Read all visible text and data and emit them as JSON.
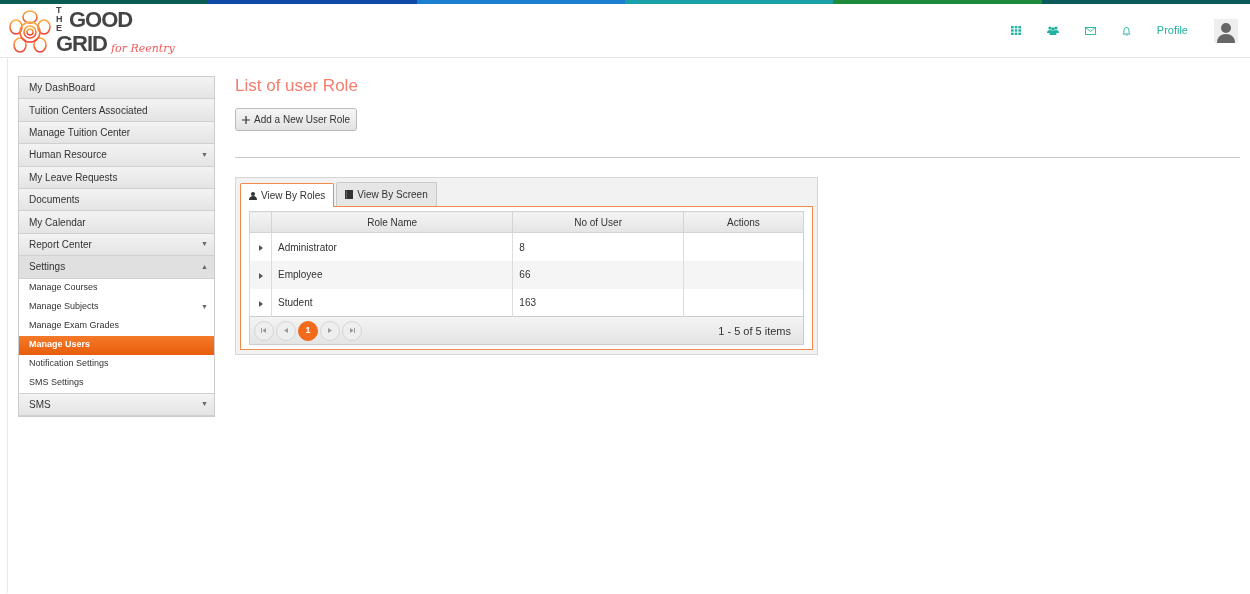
{
  "logo": {
    "the": "THE",
    "good": "GOOD",
    "grid": "GRID",
    "tagline": "for Reentry"
  },
  "header": {
    "profile": "Profile"
  },
  "sidebar": {
    "items": [
      {
        "label": "My DashBoard",
        "selected": false
      },
      {
        "label": "Tuition Centers Associated",
        "selected": false
      },
      {
        "label": "Manage Tuition Center",
        "selected": false
      },
      {
        "label": "Human Resource",
        "caret": "▼",
        "selected": false
      },
      {
        "label": "My Leave Requests",
        "selected": false
      },
      {
        "label": "Documents",
        "selected": false
      },
      {
        "label": "My Calendar",
        "selected": false
      },
      {
        "label": "Report Center",
        "caret": "▼",
        "selected": false
      },
      {
        "label": "Settings",
        "caret": "▲",
        "selected": false,
        "children": [
          {
            "label": "Manage Courses",
            "selected": false
          },
          {
            "label": "Manage Subjects",
            "caret": "▼",
            "selected": false
          },
          {
            "label": "Manage Exam Grades",
            "selected": false
          },
          {
            "label": "Manage Users",
            "selected": true
          },
          {
            "label": "Notification Settings",
            "selected": false
          },
          {
            "label": "SMS Settings",
            "selected": false
          }
        ]
      },
      {
        "label": "SMS",
        "caret": "▼",
        "selected": false
      }
    ]
  },
  "page_title": "List of user Role",
  "add_button": "Add a New User Role",
  "tabs": [
    {
      "label": "View By Roles",
      "selected": true
    },
    {
      "label": "View By Screen",
      "selected": false
    }
  ],
  "table": {
    "columns": [
      "Role Name",
      "No of User",
      "Actions"
    ],
    "rows": [
      {
        "role": "Administrator",
        "users": "8"
      },
      {
        "role": "Employee",
        "users": "66"
      },
      {
        "role": "Student",
        "users": "163"
      }
    ]
  },
  "pager": {
    "page": "1",
    "summary": "1 - 5 of 5 items"
  }
}
